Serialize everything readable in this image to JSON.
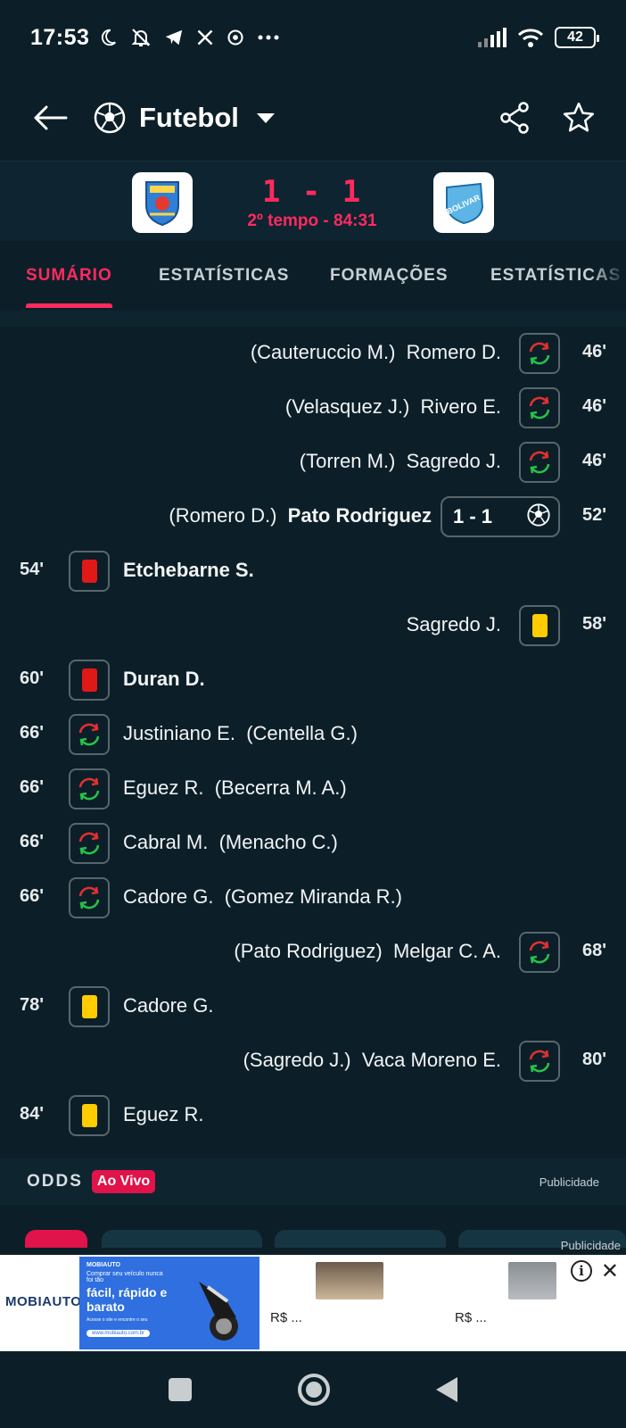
{
  "status_bar": {
    "time": "17:53",
    "battery": "42",
    "icons": [
      "moon-icon",
      "bell-off-icon",
      "telegram-icon",
      "x-icon",
      "chrome-icon",
      "more-icon"
    ]
  },
  "header": {
    "sport": "Futebol"
  },
  "match": {
    "score": "1 - 1",
    "period": "2º tempo - 84:31",
    "home_logo_icon": "club-crest-icon",
    "away_logo_icon": "bolivar-crest-icon",
    "away_logo_text": "BOLIVAR"
  },
  "tabs": [
    {
      "label": "SUMÁRIO",
      "active": true
    },
    {
      "label": "ESTATÍSTICAS",
      "active": false
    },
    {
      "label": "FORMAÇÕES",
      "active": false
    },
    {
      "label": "ESTATÍSTICAS",
      "active": false
    }
  ],
  "events": [
    {
      "side": "away",
      "type": "sub",
      "minute": "46'",
      "player": "Romero D.",
      "replaced": "(Cauteruccio M.)"
    },
    {
      "side": "away",
      "type": "sub",
      "minute": "46'",
      "player": "Rivero E.",
      "replaced": "(Velasquez J.)"
    },
    {
      "side": "away",
      "type": "sub",
      "minute": "46'",
      "player": "Sagredo J.",
      "replaced": "(Torren M.)"
    },
    {
      "side": "away",
      "type": "goal",
      "minute": "52'",
      "player": "Pato Rodriguez",
      "replaced": "(Romero D.)",
      "score": "1 - 1"
    },
    {
      "side": "home",
      "type": "red",
      "minute": "54'",
      "player": "Etchebarne S.",
      "replaced": ""
    },
    {
      "side": "away",
      "type": "yellow",
      "minute": "58'",
      "player": "Sagredo J.",
      "replaced": ""
    },
    {
      "side": "home",
      "type": "red",
      "minute": "60'",
      "player": "Duran D.",
      "replaced": ""
    },
    {
      "side": "home",
      "type": "sub",
      "minute": "66'",
      "player": "Justiniano E.",
      "replaced": "(Centella G.)"
    },
    {
      "side": "home",
      "type": "sub",
      "minute": "66'",
      "player": "Eguez R.",
      "replaced": "(Becerra M. A.)"
    },
    {
      "side": "home",
      "type": "sub",
      "minute": "66'",
      "player": "Cabral M.",
      "replaced": "(Menacho C.)"
    },
    {
      "side": "home",
      "type": "sub",
      "minute": "66'",
      "player": "Cadore G.",
      "replaced": "(Gomez Miranda R.)"
    },
    {
      "side": "away",
      "type": "sub",
      "minute": "68'",
      "player": "Melgar C. A.",
      "replaced": "(Pato Rodriguez)"
    },
    {
      "side": "home",
      "type": "yellow",
      "minute": "78'",
      "player": "Cadore G.",
      "replaced": ""
    },
    {
      "side": "away",
      "type": "sub",
      "minute": "80'",
      "player": "Vaca Moreno E.",
      "replaced": "(Sagredo J.)"
    },
    {
      "side": "home",
      "type": "yellow",
      "minute": "84'",
      "player": "Eguez R.",
      "replaced": ""
    }
  ],
  "odds": {
    "label": "ODDS",
    "live": "Ao Vivo",
    "ad_label": "Publicidade"
  },
  "ad": {
    "label": "Publicidade",
    "brand": "MOBIAUTO",
    "banner_brand": "MOBIAUTO",
    "banner_line1": "Comprar seu veículo nunca foi tão",
    "banner_headline": "fácil, rápido e barato",
    "banner_fine": "Acesse o site e encontre o seu",
    "banner_url": "www.mobiauto.com.br",
    "price1": "R$ ...",
    "price2": "R$ ..."
  },
  "colors": {
    "background": "#0c1f28",
    "accent": "#ff2a5f",
    "red_card": "#e01818",
    "yellow_card": "#ffcc00"
  }
}
